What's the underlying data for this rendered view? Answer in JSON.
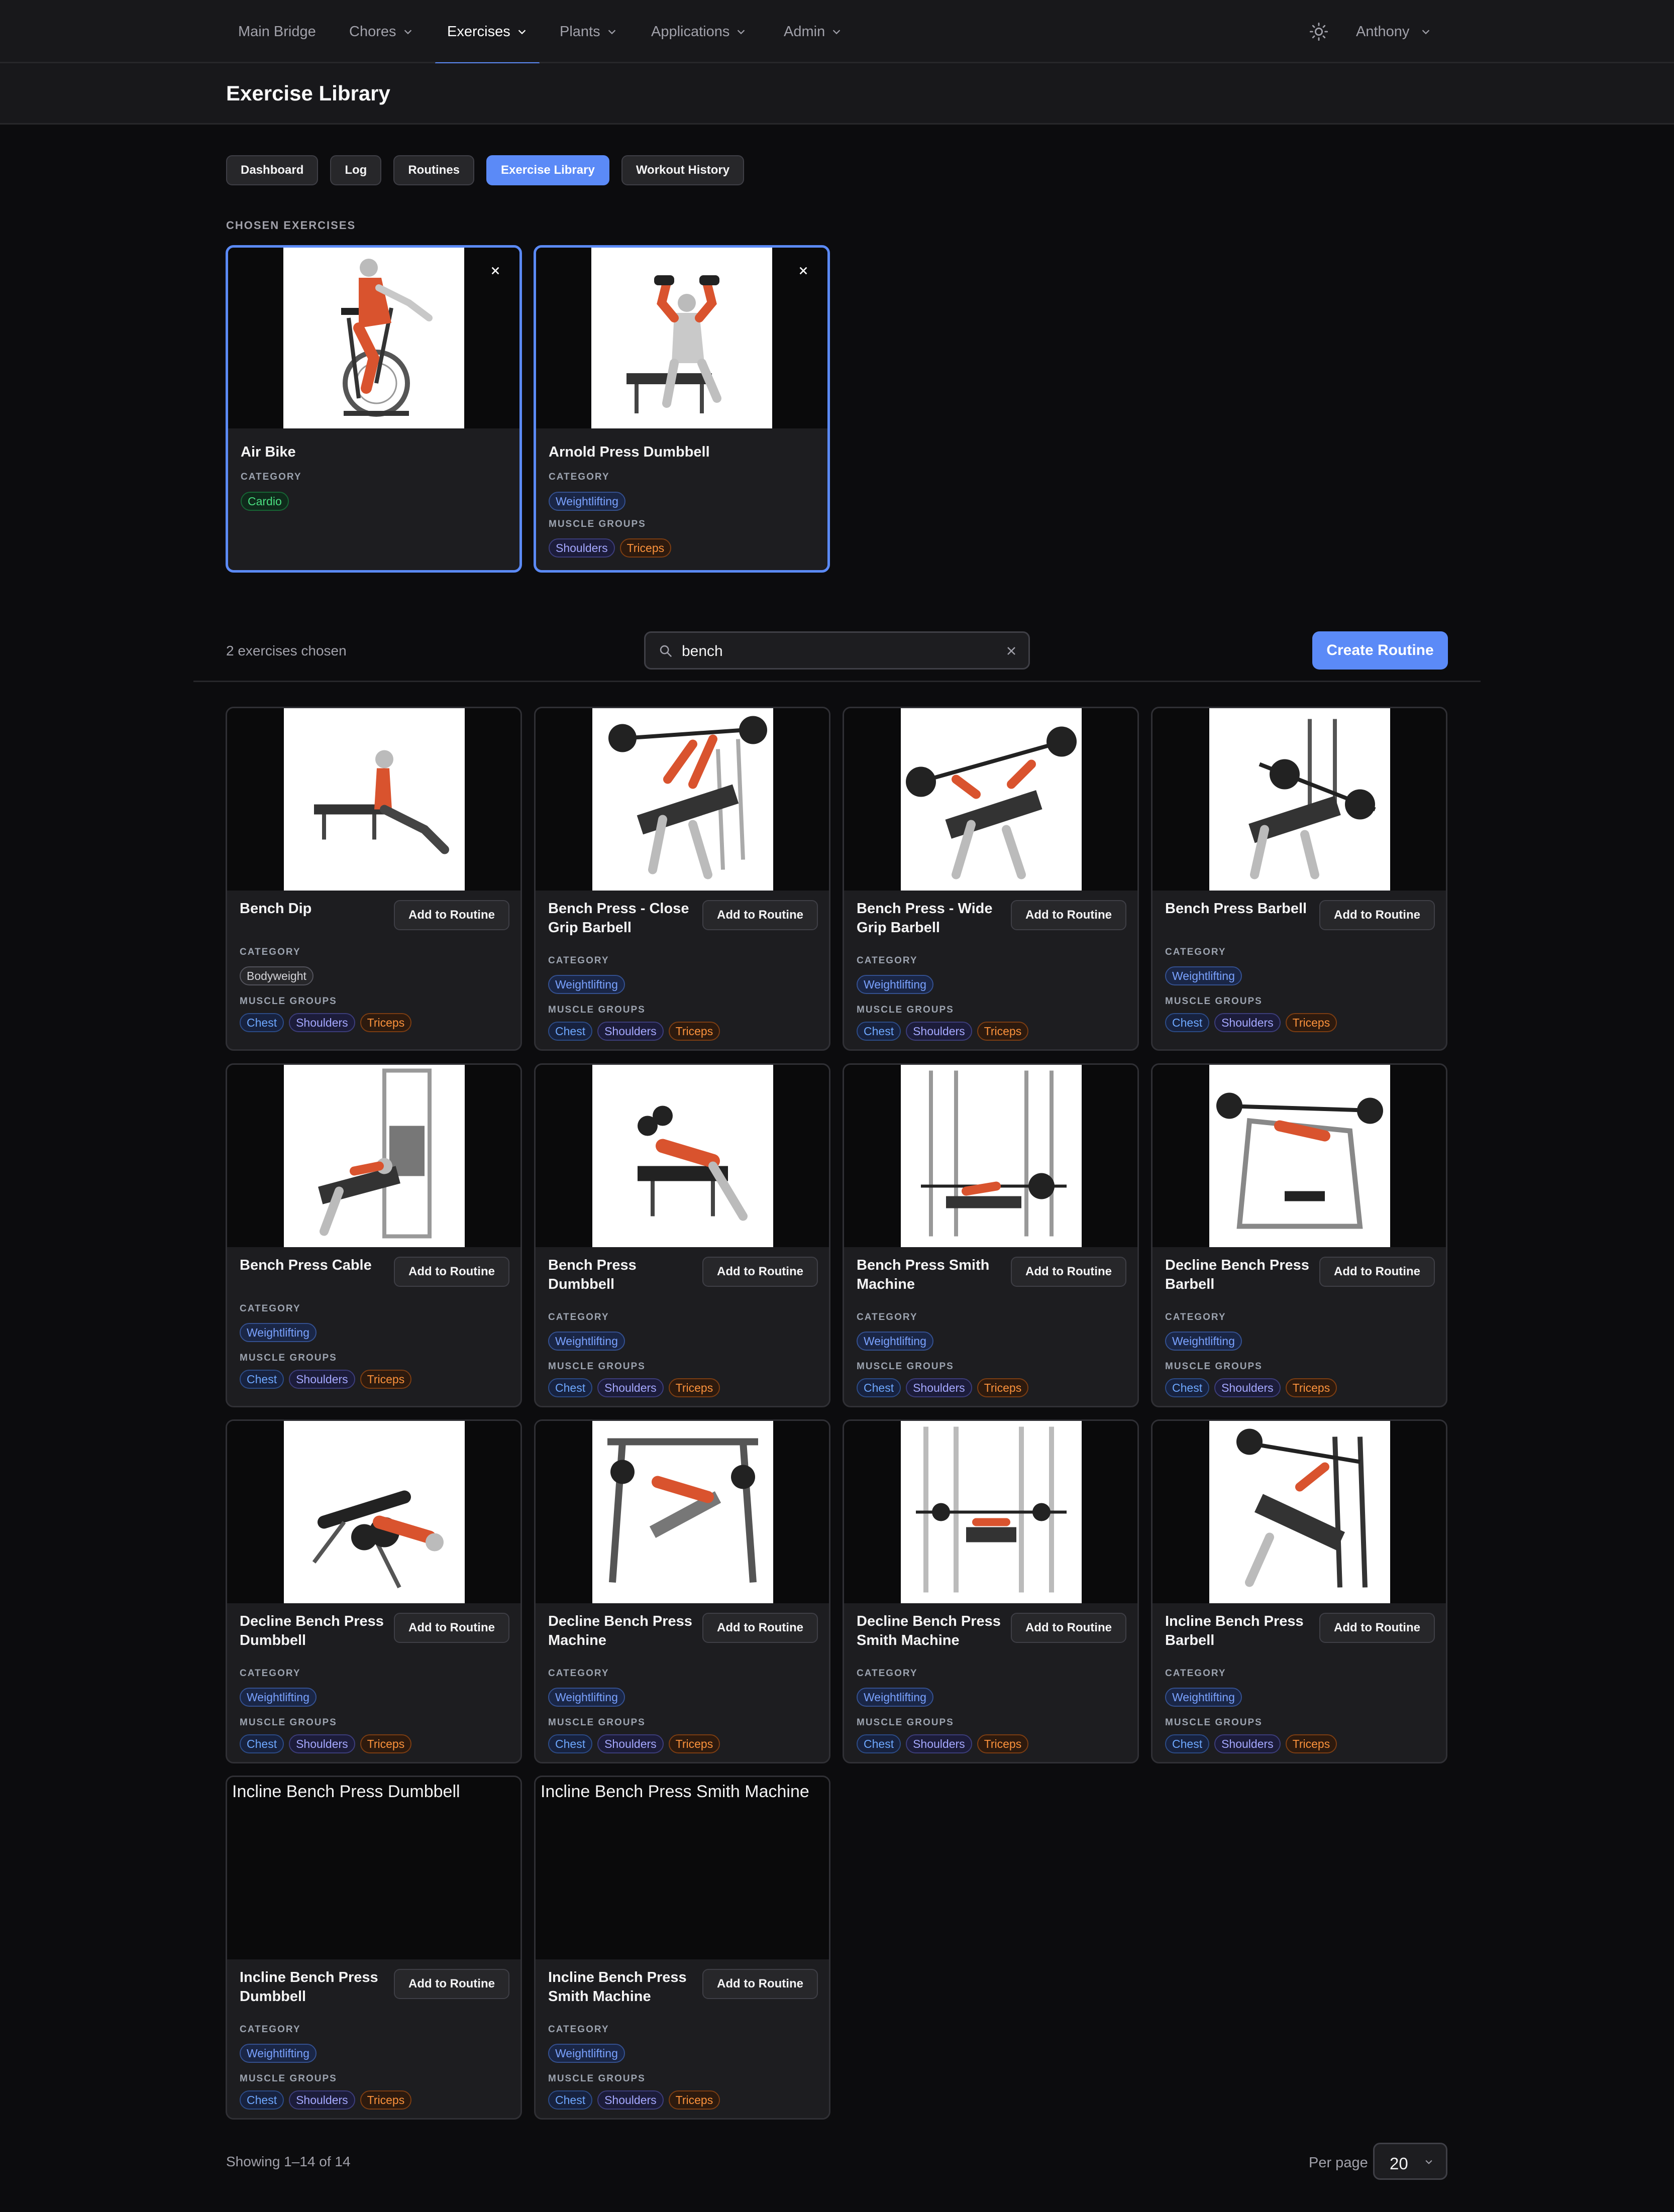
{
  "nav": {
    "items": [
      {
        "label": "Main Bridge",
        "dropdown": false,
        "active": false
      },
      {
        "label": "Chores",
        "dropdown": true,
        "active": false
      },
      {
        "label": "Exercises",
        "dropdown": true,
        "active": true
      },
      {
        "label": "Plants",
        "dropdown": true,
        "active": false
      },
      {
        "label": "Applications",
        "dropdown": true,
        "active": false
      },
      {
        "label": "Admin",
        "dropdown": true,
        "active": false
      }
    ],
    "theme_icon": "sun-icon",
    "user": "Anthony"
  },
  "page": {
    "title": "Exercise Library"
  },
  "tabs": [
    {
      "label": "Dashboard",
      "active": false
    },
    {
      "label": "Log",
      "active": false
    },
    {
      "label": "Routines",
      "active": false
    },
    {
      "label": "Exercise Library",
      "active": true
    },
    {
      "label": "Workout History",
      "active": false
    }
  ],
  "chosen": {
    "section_label": "CHOSEN EXERCISES",
    "items": [
      {
        "name": "Air Bike",
        "category": "Cardio",
        "muscles": []
      },
      {
        "name": "Arnold Press Dumbbell",
        "category": "Weightlifting",
        "muscles": [
          "Shoulders",
          "Triceps"
        ]
      }
    ]
  },
  "labels": {
    "category": "CATEGORY",
    "muscle_groups": "MUSCLE GROUPS",
    "add_to_routine": "Add to Routine"
  },
  "toolbar": {
    "chosen_count": "2 exercises chosen",
    "search_value": "bench",
    "create_button": "Create Routine"
  },
  "exercises": [
    {
      "name": "Bench Dip",
      "category": "Bodyweight",
      "muscles": [
        "Chest",
        "Shoulders",
        "Triceps"
      ],
      "image_alt": ""
    },
    {
      "name": "Bench Press - Close Grip Barbell",
      "category": "Weightlifting",
      "muscles": [
        "Chest",
        "Shoulders",
        "Triceps"
      ],
      "image_alt": ""
    },
    {
      "name": "Bench Press - Wide Grip Barbell",
      "category": "Weightlifting",
      "muscles": [
        "Chest",
        "Shoulders",
        "Triceps"
      ],
      "image_alt": ""
    },
    {
      "name": "Bench Press Barbell",
      "category": "Weightlifting",
      "muscles": [
        "Chest",
        "Shoulders",
        "Triceps"
      ],
      "image_alt": ""
    },
    {
      "name": "Bench Press Cable",
      "category": "Weightlifting",
      "muscles": [
        "Chest",
        "Shoulders",
        "Triceps"
      ],
      "image_alt": ""
    },
    {
      "name": "Bench Press Dumbbell",
      "category": "Weightlifting",
      "muscles": [
        "Chest",
        "Shoulders",
        "Triceps"
      ],
      "image_alt": ""
    },
    {
      "name": "Bench Press Smith Machine",
      "category": "Weightlifting",
      "muscles": [
        "Chest",
        "Shoulders",
        "Triceps"
      ],
      "image_alt": ""
    },
    {
      "name": "Decline Bench Press Barbell",
      "category": "Weightlifting",
      "muscles": [
        "Chest",
        "Shoulders",
        "Triceps"
      ],
      "image_alt": ""
    },
    {
      "name": "Decline Bench Press Dumbbell",
      "category": "Weightlifting",
      "muscles": [
        "Chest",
        "Shoulders",
        "Triceps"
      ],
      "image_alt": ""
    },
    {
      "name": "Decline Bench Press Machine",
      "category": "Weightlifting",
      "muscles": [
        "Chest",
        "Shoulders",
        "Triceps"
      ],
      "image_alt": ""
    },
    {
      "name": "Decline Bench Press Smith Machine",
      "category": "Weightlifting",
      "muscles": [
        "Chest",
        "Shoulders",
        "Triceps"
      ],
      "image_alt": ""
    },
    {
      "name": "Incline Bench Press Barbell",
      "category": "Weightlifting",
      "muscles": [
        "Chest",
        "Shoulders",
        "Triceps"
      ],
      "image_alt": ""
    },
    {
      "name": "Incline Bench Press Dumbbell",
      "category": "Weightlifting",
      "muscles": [
        "Chest",
        "Shoulders",
        "Triceps"
      ],
      "image_alt": "Incline Bench Press Dumbbell"
    },
    {
      "name": "Incline Bench Press Smith Machine",
      "category": "Weightlifting",
      "muscles": [
        "Chest",
        "Shoulders",
        "Triceps"
      ],
      "image_alt": "Incline Bench Press Smith Machine"
    }
  ],
  "pagination": {
    "showing": "Showing 1–14 of 14",
    "per_page_label": "Per page",
    "per_page_value": "20"
  },
  "colors": {
    "accent": "#5b8af7",
    "background": "#0c0c0e",
    "card": "#1d1d20",
    "cardio": "#4ade80",
    "weightlifting": "#7aa2ff",
    "chest": "#6ea8ff",
    "shoulders": "#a5a8ff",
    "triceps": "#fb923c"
  }
}
